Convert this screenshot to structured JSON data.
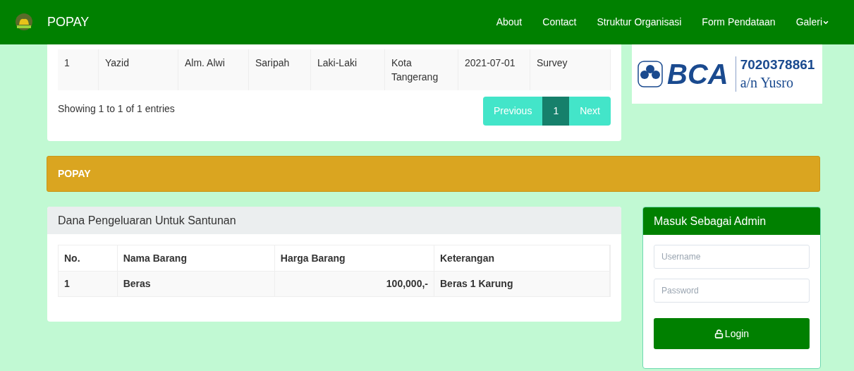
{
  "navbar": {
    "brand": "POPAY",
    "links": [
      {
        "label": "About",
        "dropdown": false
      },
      {
        "label": "Contact",
        "dropdown": false
      },
      {
        "label": "Struktur Organisasi",
        "dropdown": false
      },
      {
        "label": "Form Pendataan",
        "dropdown": false
      },
      {
        "label": "Galeri",
        "dropdown": true
      }
    ]
  },
  "members_table": {
    "rows": [
      [
        "1",
        "Yazid",
        "Alm. Alwi",
        "Saripah",
        "Laki-Laki",
        "Kota Tangerang",
        "2021-07-01",
        "Survey"
      ]
    ],
    "info": "Showing 1 to 1 of 1 entries",
    "pagination": [
      {
        "label": "Previous",
        "selected": false
      },
      {
        "label": "1",
        "selected": true
      },
      {
        "label": "Next",
        "selected": false
      }
    ]
  },
  "bank_banner": {
    "logo": "BCA",
    "account": "7020378861",
    "holder": "a/n Yusro"
  },
  "section_bar": {
    "title": "POPAY"
  },
  "expenses": {
    "title": "Dana Pengeluaran Untuk Santunan",
    "columns": [
      "No.",
      "Nama Barang",
      "Harga Barang",
      "Keterangan"
    ],
    "rows": [
      [
        "1",
        "Beras",
        "100,000,-",
        "Beras 1 Karung"
      ]
    ]
  },
  "login": {
    "title": "Masuk Sebagai Admin",
    "username": {
      "placeholder": "Username"
    },
    "password": {
      "placeholder": "Password"
    },
    "button": "Login"
  }
}
